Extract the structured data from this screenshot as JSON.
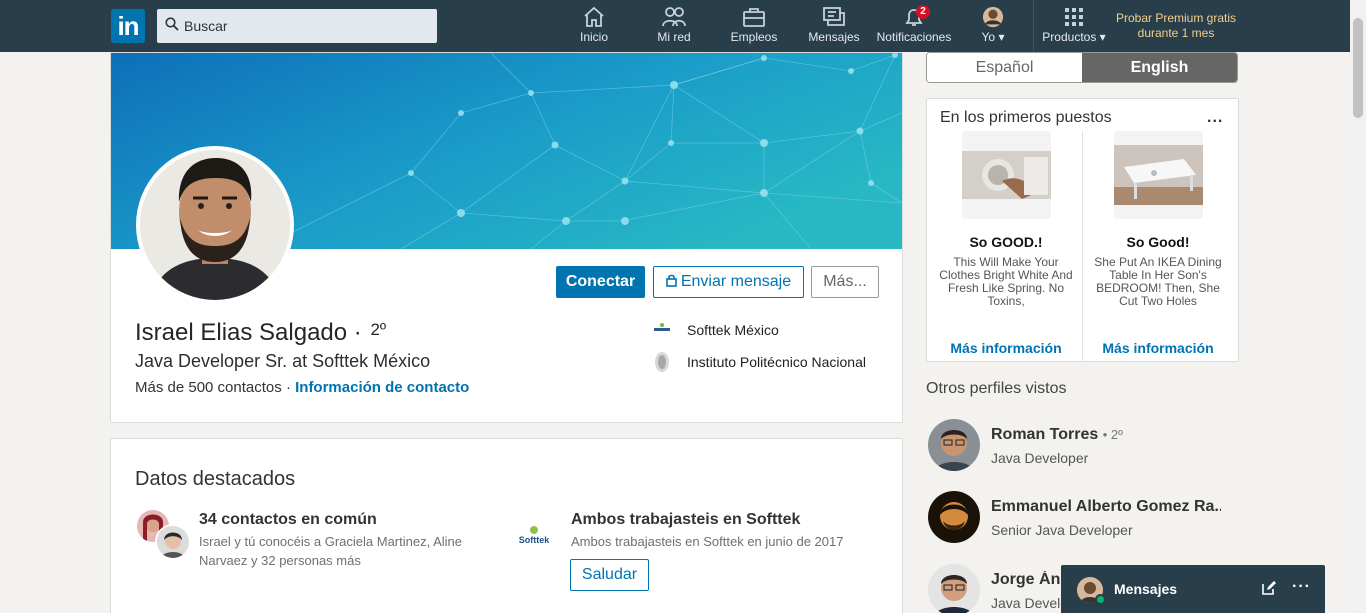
{
  "nav": {
    "logo": "in",
    "search_placeholder": "Buscar",
    "items": [
      {
        "label": "Inicio",
        "icon": "home-icon"
      },
      {
        "label": "Mi red",
        "icon": "network-icon"
      },
      {
        "label": "Empleos",
        "icon": "briefcase-icon"
      },
      {
        "label": "Mensajes",
        "icon": "messages-icon"
      },
      {
        "label": "Notificaciones",
        "icon": "bell-icon",
        "badge": "2"
      },
      {
        "label": "Yo",
        "icon": "avatar"
      },
      {
        "label": "Productos",
        "icon": "grid-icon"
      }
    ],
    "premium": "Probar Premium gratis durante 1 mes"
  },
  "profile": {
    "name": "Israel Elias Salgado",
    "degree": "2º",
    "headline": "Java Developer Sr. at Softtek México",
    "connections": "Más de 500 contactos",
    "separator": "·",
    "contact_info": "Información de contacto",
    "connect": "Conectar",
    "message": "Enviar mensaje",
    "more": "Más...",
    "orgs": [
      {
        "name": "Softtek México",
        "icon": "softtek-logo"
      },
      {
        "name": "Instituto Politécnico Nacional",
        "icon": "ipn-logo"
      }
    ]
  },
  "highlights": {
    "title": "Datos destacados",
    "common": {
      "title": "34 contactos en común",
      "desc": "Israel y tú conocéis a Graciela Martinez, Aline Narvaez y 32 personas más"
    },
    "worked": {
      "logo": "Softtek",
      "title": "Ambos trabajasteis en Softtek",
      "desc": "Ambos trabajasteis en Softtek en junio de 2017",
      "button": "Saludar"
    }
  },
  "lang": {
    "es": "Español",
    "en": "English",
    "selected": "English"
  },
  "ads": {
    "title": "En los primeros puestos",
    "dots": "...",
    "items": [
      {
        "head": "So GOOD.!",
        "desc": "This Will Make Your Clothes Bright White And Fresh Like Spring. No Toxins,",
        "link": "Más información"
      },
      {
        "head": "So Good!",
        "desc": "She Put An IKEA Dining Table In Her Son's BEDROOM! Then, She Cut Two Holes",
        "link": "Más información"
      }
    ]
  },
  "others": {
    "title": "Otros perfiles vistos",
    "people": [
      {
        "name": "Roman Torres",
        "degree": "• 2º",
        "title": "Java Developer"
      },
      {
        "name": "Emmanuel Alberto Gomez Ra...",
        "degree": "",
        "title": "Senior Java Developer"
      },
      {
        "name": "Jorge Áng",
        "degree": "",
        "title": "Java Develo"
      }
    ]
  },
  "messaging": {
    "label": "Mensajes",
    "dots": "···"
  },
  "colors": {
    "nav_bg": "#283e4a",
    "primary": "#0073b1",
    "premium": "#f5cf8c",
    "badge": "#d11124"
  }
}
